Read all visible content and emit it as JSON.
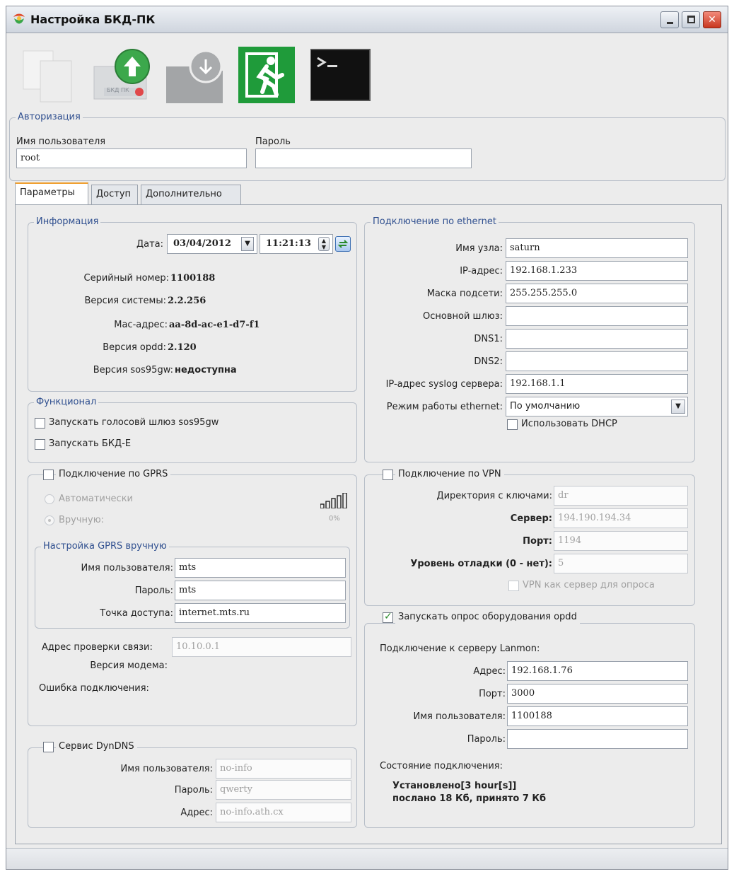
{
  "window": {
    "title": "Настройка БКД-ПК"
  },
  "toolbar": {
    "upload_icon_caption": "БКД ПК"
  },
  "auth": {
    "legend": "Авторизация",
    "username_label": "Имя пользователя",
    "username_value": "root",
    "password_label": "Пароль",
    "password_value": ""
  },
  "tabs": [
    "Параметры",
    "Доступ",
    "Дополнительно"
  ],
  "info": {
    "legend": "Информация",
    "date_label": "Дата:",
    "date_value": "03/04/2012",
    "time_value": "11:21:13",
    "serial_label": "Серийный номер:",
    "serial_value": "1100188",
    "system_label": "Версия системы:",
    "system_value": "2.2.256",
    "mac_label": "Mac-адрес:",
    "mac_value": "aa-8d-ac-e1-d7-f1",
    "opdd_label": "Версия opdd:",
    "opdd_value": "2.120",
    "sos_label": "Версия sos95gw:",
    "sos_value": "недоступна"
  },
  "func": {
    "legend": "Функционал",
    "run_gateway": "Запускать голосовй шлюз sos95gw",
    "run_bkd": "Запускать БКД-Е"
  },
  "gprs": {
    "legend": "Подключение по GPRS",
    "auto_label": "Автоматически",
    "manual_label": "Вручную:",
    "signal_text": "0%",
    "manual_legend": "Настройка GPRS вручную",
    "user_label": "Имя пользователя:",
    "user_value": "mts",
    "pass_label": "Пароль:",
    "pass_value": "mts",
    "apn_label": "Точка доступа:",
    "apn_value": "internet.mts.ru",
    "check_label": "Адрес проверки связи:",
    "check_value": "10.10.0.1",
    "modem_label": "Версия модема:",
    "error_label": "Ошибка подключения:"
  },
  "dyndns": {
    "legend": "Сервис DynDNS",
    "user_label": "Имя пользователя:",
    "user_value": "no-info",
    "pass_label": "Пароль:",
    "pass_value": "qwerty",
    "addr_label": "Адрес:",
    "addr_value": "no-info.ath.cx"
  },
  "ethernet": {
    "legend": "Подключение по ethernet",
    "host_label": "Имя узла:",
    "host_value": "saturn",
    "ip_label": "IP-адрес:",
    "ip_value": "192.168.1.233",
    "mask_label": "Маска подсети:",
    "mask_value": "255.255.255.0",
    "gw_label": "Основной шлюз:",
    "gw_value": "",
    "dns1_label": "DNS1:",
    "dns1_value": "",
    "dns2_label": "DNS2:",
    "dns2_value": "",
    "syslog_label": "IP-адрес syslog сервера:",
    "syslog_value": "192.168.1.1",
    "mode_label": "Режим работы ethernet:",
    "mode_value": "По умолчанию",
    "dhcp_label": "Использовать DHCP"
  },
  "vpn": {
    "legend": "Подключение по VPN",
    "dir_label": "Директория с ключами:",
    "dir_value": "dr",
    "server_label": "Сервер:",
    "server_value": "194.190.194.34",
    "port_label": "Порт:",
    "port_value": "1194",
    "debug_label": "Уровень отладки (0 - нет):",
    "debug_value": "5",
    "as_server_label": "VPN как сервер для опроса"
  },
  "opdd": {
    "legend": "Запускать опрос оборудования opdd",
    "server_header": "Подключение к серверу Lanmon:",
    "addr_label": "Адрес:",
    "addr_value": "192.168.1.76",
    "port_label": "Порт:",
    "port_value": "3000",
    "user_label": "Имя пользователя:",
    "user_value": "1100188",
    "pass_label": "Пароль:",
    "pass_value": "",
    "state_label": "Состояние подключения:",
    "state_line1": "Установлено[3 hour[s]]",
    "state_line2": "послано 18 Кб, принято 7 Кб"
  }
}
